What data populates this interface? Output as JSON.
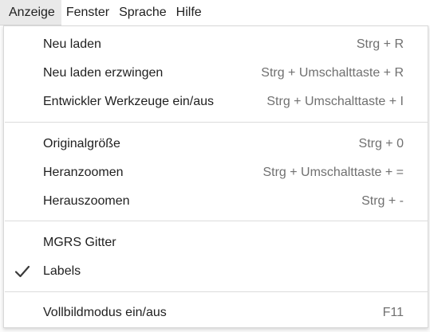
{
  "menubar": {
    "items": [
      {
        "label": "Anzeige"
      },
      {
        "label": "Fenster"
      },
      {
        "label": "Sprache"
      },
      {
        "label": "Hilfe"
      }
    ]
  },
  "view_menu": {
    "items": [
      {
        "label": "Neu laden",
        "shortcut": "Strg + R"
      },
      {
        "label": "Neu laden erzwingen",
        "shortcut": "Strg + Umschalttaste + R"
      },
      {
        "label": "Entwickler Werkzeuge ein/aus",
        "shortcut": "Strg + Umschalttaste + I"
      },
      {
        "label": "Originalgröße",
        "shortcut": "Strg + 0"
      },
      {
        "label": "Heranzoomen",
        "shortcut": "Strg + Umschalttaste + ="
      },
      {
        "label": "Herauszoomen",
        "shortcut": "Strg + -"
      },
      {
        "label": "MGRS Gitter",
        "checked": false
      },
      {
        "label": "Labels",
        "checked": true,
        "icon": "checkmark-icon"
      },
      {
        "label": "Vollbildmodus ein/aus",
        "shortcut": "F11"
      }
    ]
  }
}
